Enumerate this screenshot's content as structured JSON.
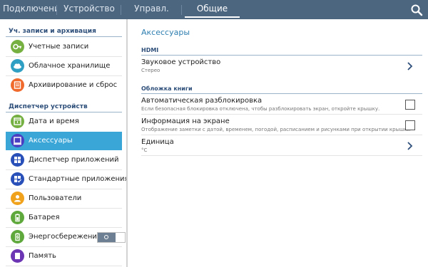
{
  "top_tabs": [
    {
      "label": "Подключени"
    },
    {
      "label": "Устройство"
    },
    {
      "label": "Управл."
    },
    {
      "label": "Общие"
    }
  ],
  "colors": {
    "topbar": "#4d6680",
    "accent": "#3aa6d8",
    "section_text": "#2e4f7a"
  },
  "sidebar": {
    "group1": {
      "title": "Уч. записи и архивация",
      "items": [
        {
          "label": "Учетные записи",
          "icon": "key-icon",
          "color": "#76b041"
        },
        {
          "label": "Облачное хранилище",
          "icon": "cloud-icon",
          "color": "#2f9fc3"
        },
        {
          "label": "Архивирование и сброс",
          "icon": "backup-icon",
          "color": "#ef6a2c"
        }
      ]
    },
    "group2": {
      "title": "Диспетчер устройств",
      "items": [
        {
          "label": "Дата и время",
          "icon": "calendar-clock-icon",
          "color": "#75b043"
        },
        {
          "label": "Аксессуары",
          "icon": "accessory-icon",
          "color": "#4a3fc2"
        },
        {
          "label": "Диспетчер приложений",
          "icon": "app-grid-icon",
          "color": "#2850b8"
        },
        {
          "label": "Стандартные приложения",
          "icon": "default-apps-icon",
          "color": "#2850b8"
        },
        {
          "label": "Пользователи",
          "icon": "users-icon",
          "color": "#f0a21c"
        },
        {
          "label": "Батарея",
          "icon": "battery-icon",
          "color": "#5fa83c"
        },
        {
          "label": "Энергосбережение",
          "icon": "power-saving-icon",
          "color": "#5fa83c"
        },
        {
          "label": "Память",
          "icon": "storage-icon",
          "color": "#6c35b3"
        }
      ]
    },
    "selected_label": "Аксессуары",
    "power_saving_toggle": "off"
  },
  "main": {
    "title": "Аксессуары",
    "hdmi": {
      "header": "HDMI",
      "audio": {
        "title": "Звуковое устройство",
        "subtitle": "Стерео"
      }
    },
    "book_cover": {
      "header": "Обложка книги",
      "auto_unlock": {
        "title": "Автоматическая разблокировка",
        "subtitle": "Если безопасная блокировка отключена, чтобы разблокировать экран, откройте крышку.",
        "checked": false
      },
      "screen_info": {
        "title": "Информация на экране",
        "subtitle": "Отображение заметки с датой, временем, погодой, расписанием и рисунками при открытии крышки",
        "checked": false
      },
      "unit": {
        "title": "Единица",
        "subtitle": "°C"
      }
    }
  }
}
